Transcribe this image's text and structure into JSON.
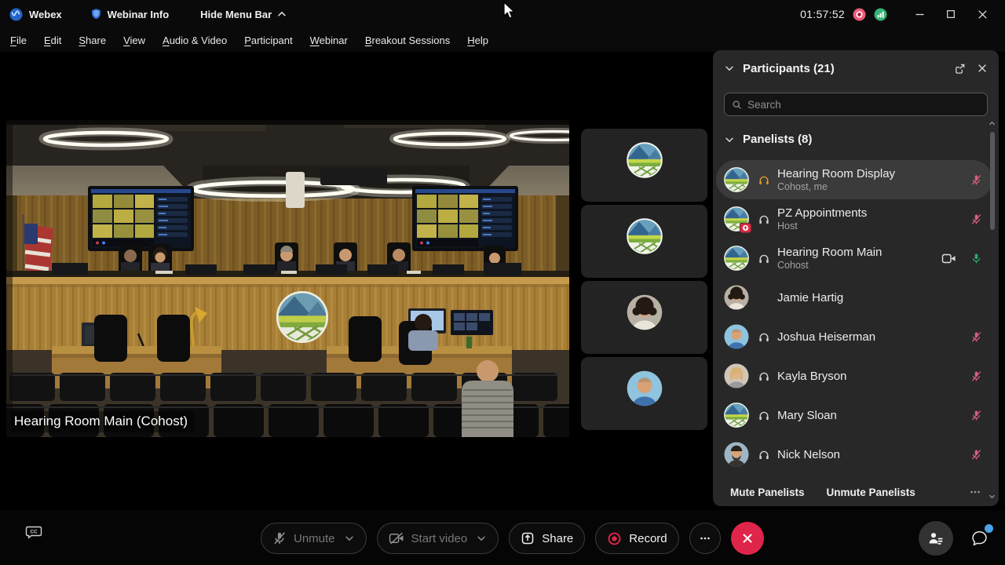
{
  "title_bar": {
    "app_name": "Webex",
    "webinar_info": "Webinar Info",
    "hide_menu": "Hide Menu Bar",
    "timer": "01:57:52"
  },
  "menu": {
    "items": [
      "File",
      "Edit",
      "Share",
      "View",
      "Audio & Video",
      "Participant",
      "Webinar",
      "Breakout Sessions",
      "Help"
    ]
  },
  "stage": {
    "main_video_label": "Hearing Room Main (Cohost)",
    "thumbnails": [
      {
        "avatar": "logo"
      },
      {
        "avatar": "logo"
      },
      {
        "avatar": "jamie"
      },
      {
        "avatar": "joshua"
      }
    ]
  },
  "participants_panel": {
    "title": "Participants (21)",
    "search_placeholder": "Search",
    "section_label": "Panelists (8)",
    "rows": [
      {
        "name": "Hearing Room Display",
        "role": "Cohost, me",
        "avatar": "logo",
        "headset": "orange",
        "mic": "muted",
        "selected": true
      },
      {
        "name": "PZ Appointments",
        "role": "Host",
        "avatar": "logo",
        "badge": true,
        "headset": "white",
        "mic": "muted"
      },
      {
        "name": "Hearing Room Main",
        "role": "Cohost",
        "avatar": "logo",
        "headset": "white",
        "camera": true,
        "mic": "active"
      },
      {
        "name": "Jamie Hartig",
        "role": "",
        "avatar": "jamie"
      },
      {
        "name": "Joshua Heiserman",
        "role": "",
        "avatar": "joshua",
        "headset": "white",
        "mic": "muted"
      },
      {
        "name": "Kayla Bryson",
        "role": "",
        "avatar": "kayla",
        "headset": "white",
        "mic": "muted"
      },
      {
        "name": "Mary Sloan",
        "role": "",
        "avatar": "logo",
        "headset": "white",
        "mic": "muted"
      },
      {
        "name": "Nick Nelson",
        "role": "",
        "avatar": "nick",
        "headset": "white",
        "mic": "muted"
      }
    ],
    "footer": {
      "mute_label": "Mute Panelists",
      "unmute_label": "Unmute Panelists"
    }
  },
  "controls": {
    "unmute_label": "Unmute",
    "start_video_label": "Start video",
    "share_label": "Share",
    "record_label": "Record"
  },
  "avatars": {
    "jamie": {
      "bg": "#b9b0a4",
      "hair": "#241a14",
      "skin": "#d9a47e",
      "shirt": "#e8e4da",
      "style": "curly"
    },
    "joshua": {
      "bg": "#8fc3de",
      "hair": "#9a8366",
      "skin": "#d8a276",
      "shirt": "#3f72ad",
      "style": "bald"
    },
    "kayla": {
      "bg": "#cfc6b8",
      "hair": "#d8b274",
      "skin": "#e2b28c",
      "shirt": "#9a9a9a",
      "style": "long"
    },
    "nick": {
      "bg": "#9db6c6",
      "hair": "#2a211a",
      "skin": "#d8a276",
      "shirt": "#35332f",
      "style": "beard"
    }
  },
  "colors": {
    "accent_blue": "#3b82f6",
    "leave_red": "#e0254a",
    "mic_muted": "#d95f7f",
    "mic_active": "#2eaf6e",
    "headset_orange": "#d89a2e",
    "notification_blue": "#4aa3e8"
  }
}
